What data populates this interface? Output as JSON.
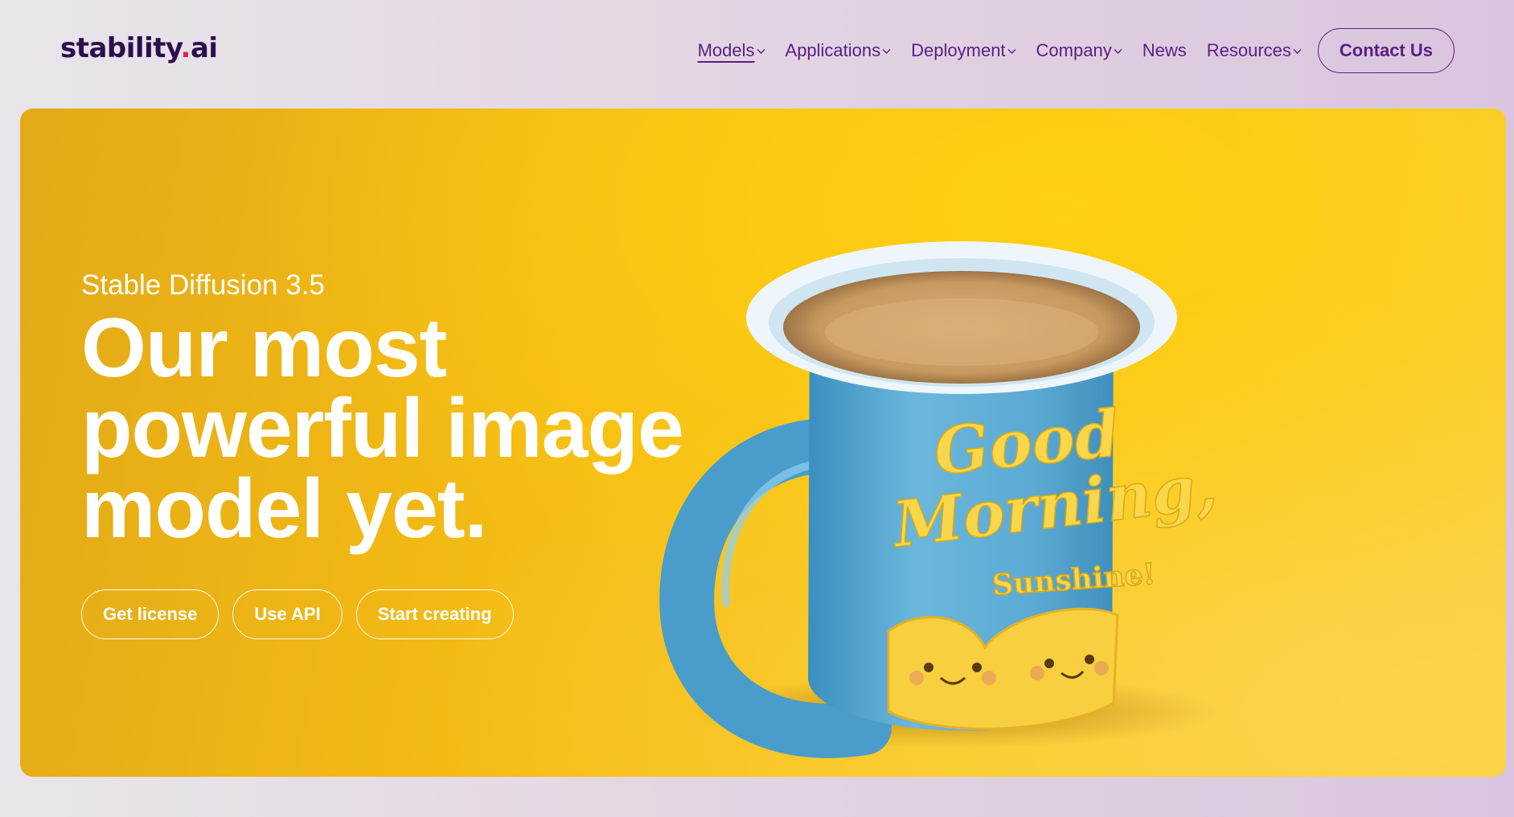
{
  "header": {
    "logo_main": "stability",
    "logo_dot": ".",
    "logo_suffix": "ai",
    "nav": [
      {
        "label": "Models",
        "has_dropdown": true,
        "active": true
      },
      {
        "label": "Applications",
        "has_dropdown": true
      },
      {
        "label": "Deployment",
        "has_dropdown": true
      },
      {
        "label": "Company",
        "has_dropdown": true
      },
      {
        "label": "News",
        "has_dropdown": false
      },
      {
        "label": "Resources",
        "has_dropdown": true
      }
    ],
    "contact_label": "Contact Us"
  },
  "hero": {
    "eyebrow": "Stable Diffusion 3.5",
    "headline_lines": [
      "Our most",
      "powerful image",
      "model yet."
    ],
    "buttons": [
      "Get license",
      "Use API",
      "Start creating"
    ],
    "image": {
      "icon": "coffee-mug-illustration",
      "mug_text_1": "Good",
      "mug_text_2": "Morning,",
      "mug_text_3": "Sunshine!"
    }
  },
  "colors": {
    "brand_purple": "#5b1c86",
    "logo_dark": "#2c0f4e",
    "logo_dot": "#e0284b",
    "hero_yellow": "#f9c51b",
    "mug_blue": "#5ba9d3"
  }
}
